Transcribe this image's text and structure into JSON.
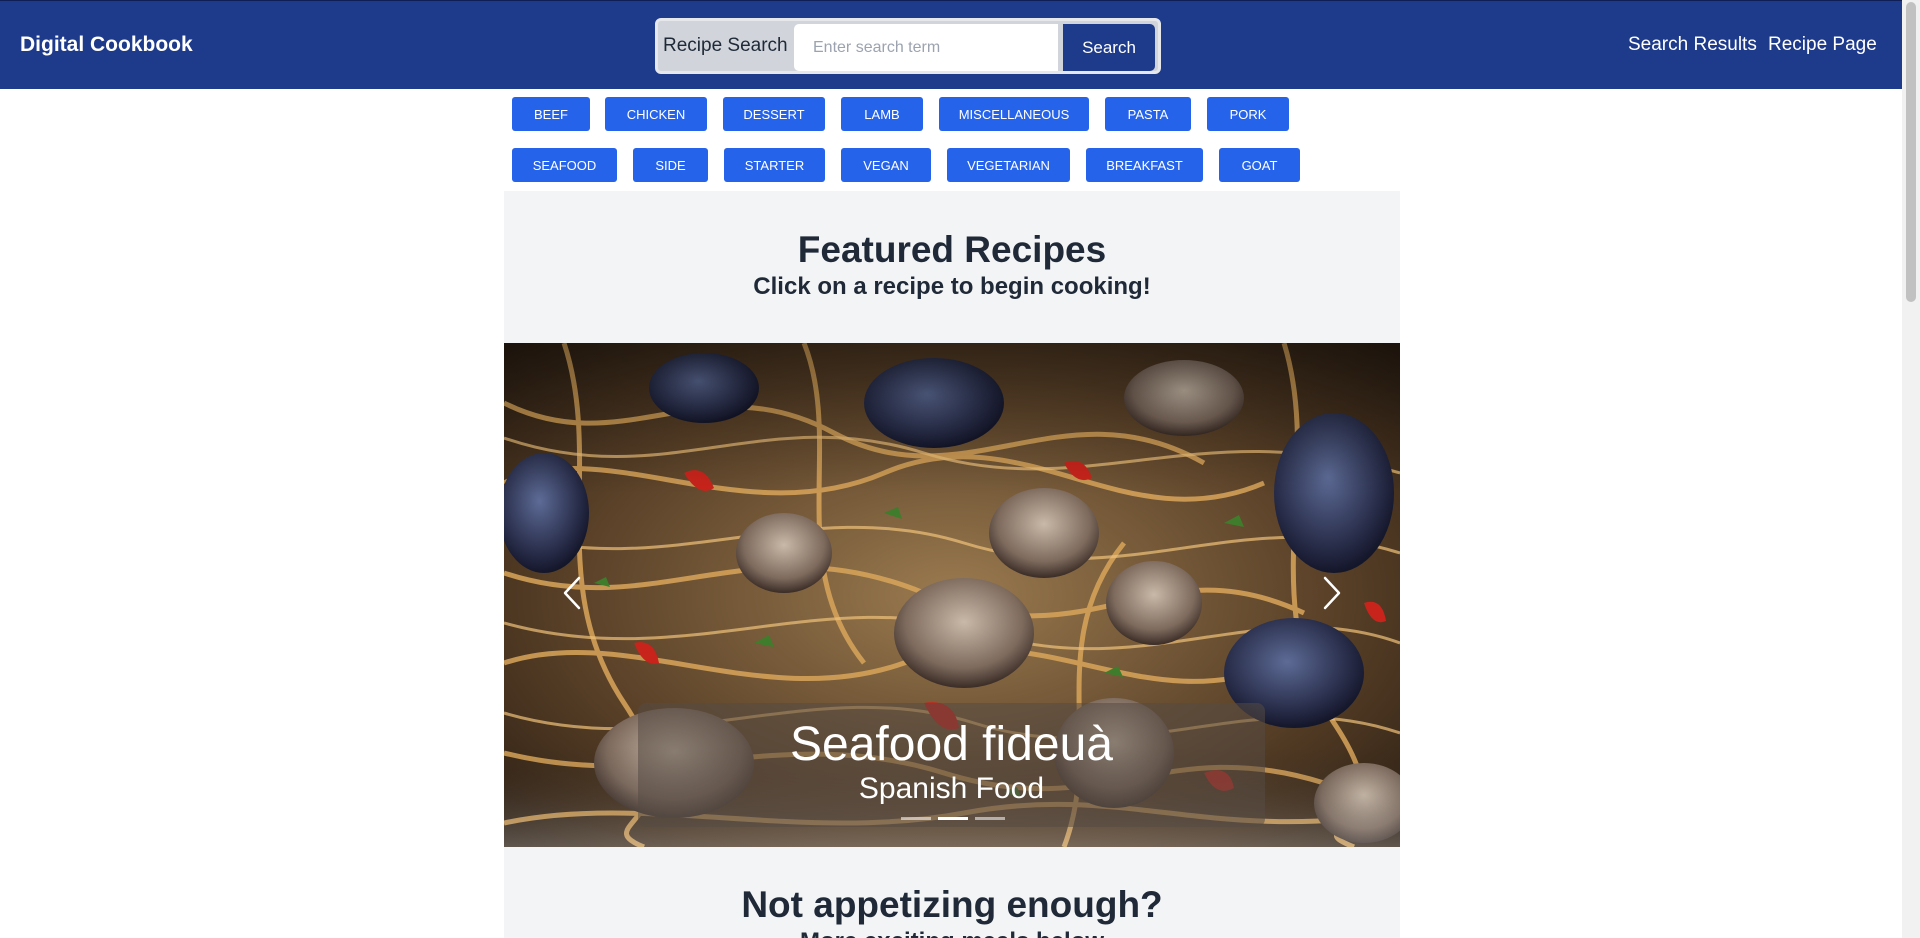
{
  "header": {
    "brand": "Digital Cookbook",
    "search_label": "Recipe Search",
    "search_placeholder": "Enter search term",
    "search_value": "",
    "search_button": "Search",
    "nav": [
      "Search Results",
      "Recipe Page"
    ],
    "color": "#1e3a8a"
  },
  "categories": {
    "row1": [
      "BEEF",
      "CHICKEN",
      "DESSERT",
      "LAMB",
      "MISCELLANEOUS",
      "PASTA",
      "PORK"
    ],
    "row2": [
      "SEAFOOD",
      "SIDE",
      "STARTER",
      "VEGAN",
      "VEGETARIAN",
      "BREAKFAST",
      "GOAT"
    ],
    "color": "#2563eb"
  },
  "featured": {
    "title": "Featured Recipes",
    "subtitle": "Click on a recipe to begin cooking!"
  },
  "carousel": {
    "slide_title": "Seafood fideuà",
    "slide_subtitle": "Spanish Food",
    "slide_count": 3,
    "active_index": 1,
    "prev_icon": "chevron-left-icon",
    "next_icon": "chevron-right-icon"
  },
  "lower": {
    "title": "Not appetizing enough?",
    "subtitle": "More exciting meals below"
  }
}
